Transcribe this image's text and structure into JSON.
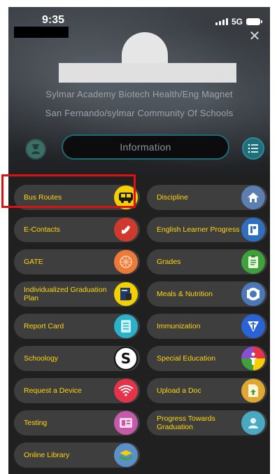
{
  "status": {
    "time": "9:35",
    "network": "5G"
  },
  "school": {
    "name_line1": "Sylmar Academy Biotech Health/Eng Magnet",
    "name_line2": "San Fernando/sylmar Community Of Schools"
  },
  "info_button": {
    "label": "Information"
  },
  "tiles": [
    {
      "label": "Bus Routes",
      "icon": "bus-icon",
      "color": "#f5d000"
    },
    {
      "label": "Discipline",
      "icon": "house-icon",
      "color": "#5b7fb0"
    },
    {
      "label": "E-Contacts",
      "icon": "phone-icon",
      "color": "#d03a2e"
    },
    {
      "label": "English Learner Progress",
      "icon": "document-icon",
      "color": "#2f6fc0"
    },
    {
      "label": "GATE",
      "icon": "gate-icon",
      "color": "#ee7a3a"
    },
    {
      "label": "Grades",
      "icon": "clipboard-icon",
      "color": "#3fa13a"
    },
    {
      "label": "Individualized Graduation Plan",
      "icon": "plan-icon",
      "color": "#f5d000"
    },
    {
      "label": "Meals & Nutrition",
      "icon": "meals-icon",
      "color": "#4a78b8"
    },
    {
      "label": "Report Card",
      "icon": "report-card-icon",
      "color": "#2ab3c8"
    },
    {
      "label": "Immunization",
      "icon": "medical-icon",
      "color": "#2a63d8"
    },
    {
      "label": "Schoology",
      "icon": "schoology-icon",
      "color": "#ffffff"
    },
    {
      "label": "Special Education",
      "icon": "special-education-icon",
      "color": "#8a4fd0"
    },
    {
      "label": "Request a Device",
      "icon": "wifi-icon",
      "color": "#e6334a"
    },
    {
      "label": "Upload a Doc",
      "icon": "upload-doc-icon",
      "color": "#e0a830"
    },
    {
      "label": "Testing",
      "icon": "testing-icon",
      "color": "#c65aa8"
    },
    {
      "label": "Progress Towards Graduation",
      "icon": "graduation-icon",
      "color": "#4aa8c0"
    },
    {
      "label": "Online Library",
      "icon": "library-icon",
      "color": "#5b8fc8"
    }
  ]
}
